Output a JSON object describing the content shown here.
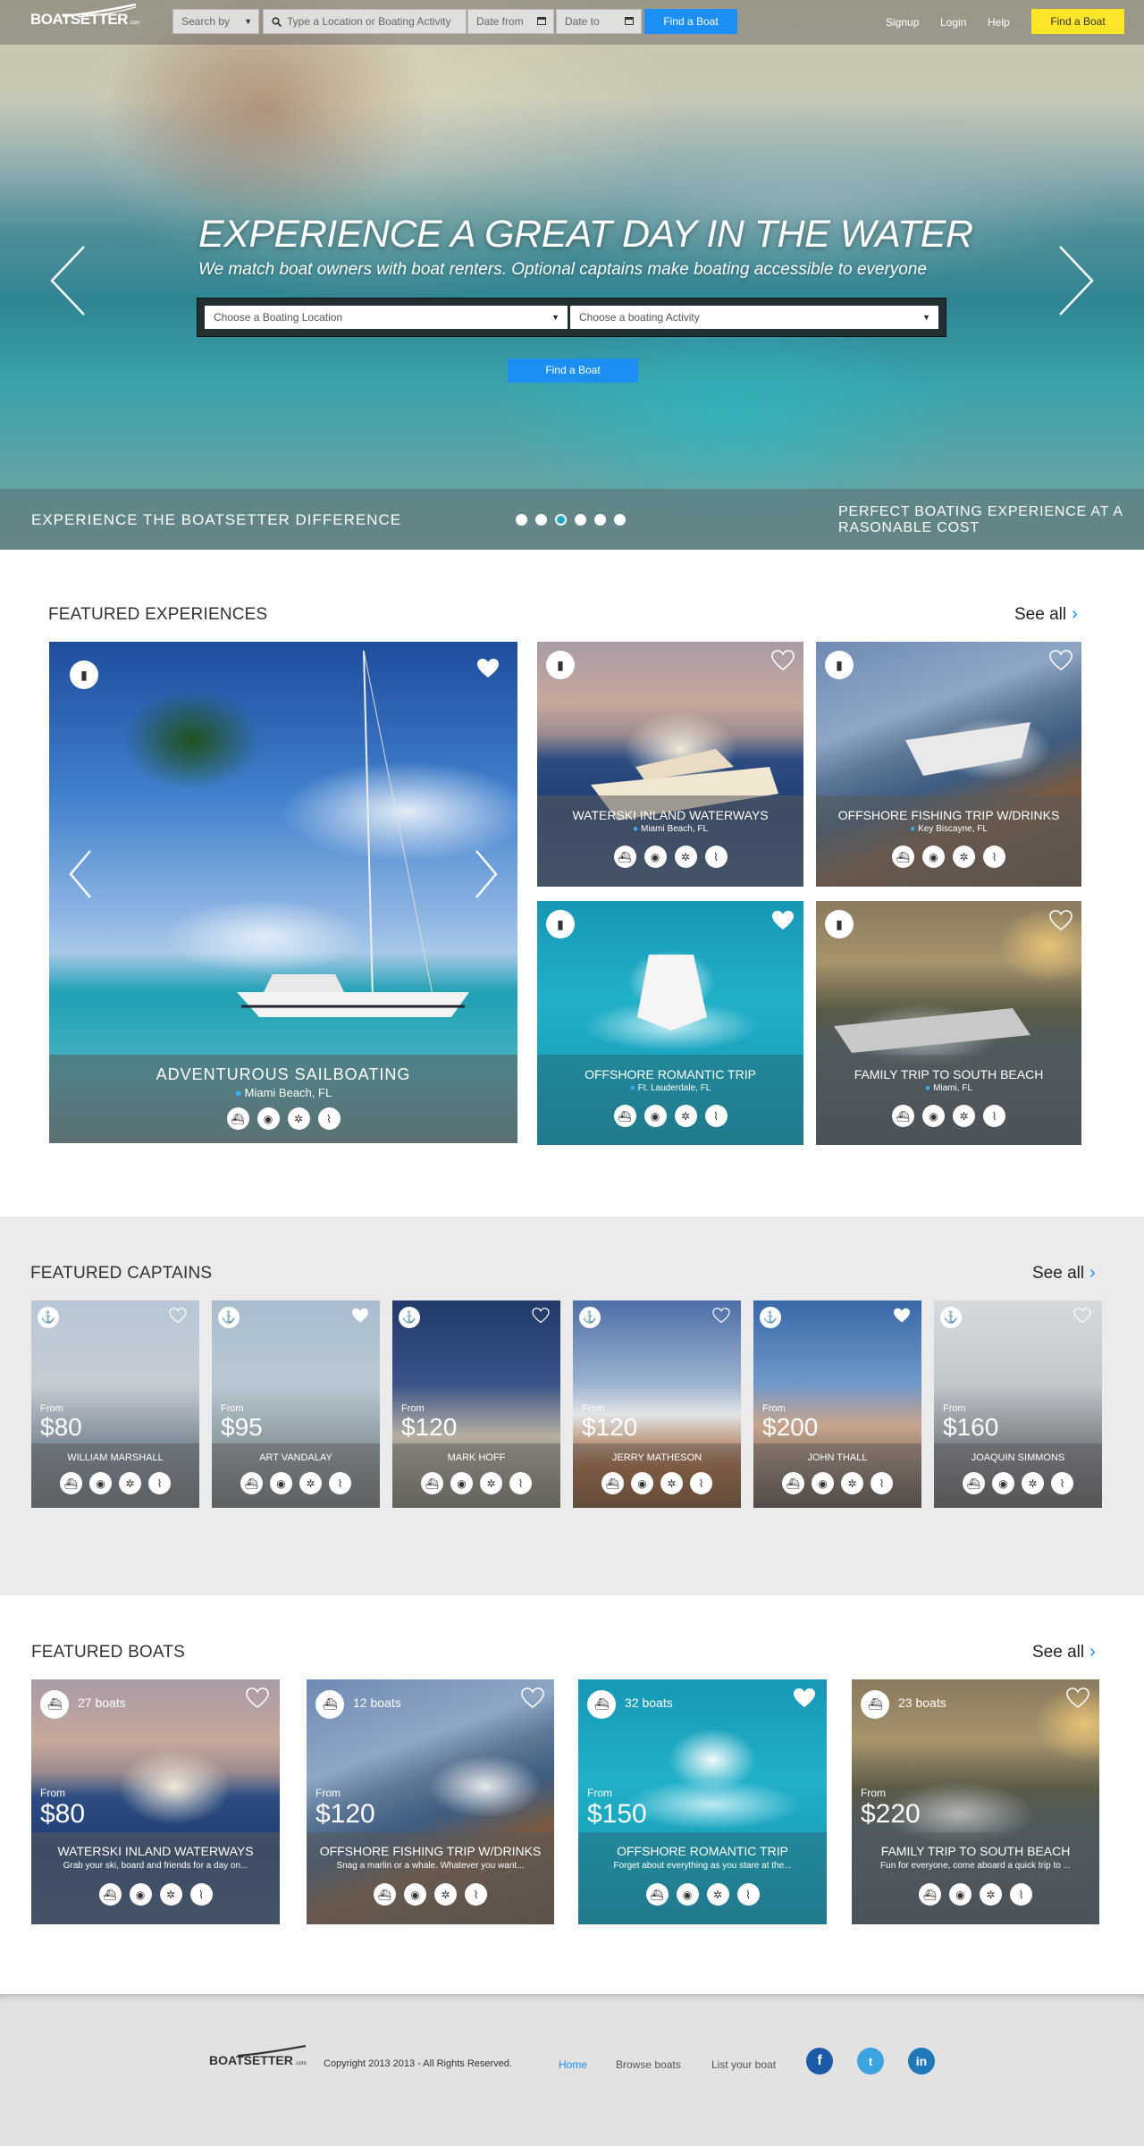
{
  "header": {
    "logo": "BOATSETTER",
    "logo_suffix": ".com",
    "search_by": "Search by",
    "location_placeholder": "Type a Location or Boating Activity",
    "date_from": "Date from",
    "date_to": "Date to",
    "find_button": "Find a Boat",
    "nav": {
      "signup": "Signup",
      "login": "Login",
      "help": "Help"
    },
    "cta": "Find a Boat"
  },
  "hero": {
    "title": "EXPERIENCE A GREAT DAY IN THE WATER",
    "subtitle": "We match boat owners with boat renters. Optional captains make boating accessible to everyone",
    "location_select": "Choose a Boating Location",
    "activity_select": "Choose a boating Activity",
    "find_button": "Find a Boat",
    "band_left": "EXPERIENCE THE BOATSETTER DIFFERENCE",
    "band_right": "PERFECT BOATING EXPERIENCE AT A RASONABLE COST",
    "slides_total": 6,
    "active_slide": 3
  },
  "experiences": {
    "title": "FEATURED EXPERIENCES",
    "see_all": "See all",
    "items": [
      {
        "title": "ADVENTUROUS SAILBOATING",
        "location": "Miami Beach, FL",
        "favorited": true
      },
      {
        "title": "WATERSKI INLAND WATERWAYS",
        "location": "Miami Beach, FL",
        "favorited": false
      },
      {
        "title": "OFFSHORE FISHING TRIP W/DRINKS",
        "location": "Key Biscayne, FL",
        "favorited": false
      },
      {
        "title": "OFFSHORE ROMANTIC TRIP",
        "location": "Ft. Lauderdale, FL",
        "favorited": true
      },
      {
        "title": "FAMILY TRIP TO SOUTH BEACH",
        "location": "Miami, FL",
        "favorited": false
      }
    ]
  },
  "captains": {
    "title": "FEATURED CAPTAINS",
    "see_all": "See all",
    "from_label": "From",
    "items": [
      {
        "name": "WILLIAM MARSHALL",
        "price": "$80",
        "favorited": false
      },
      {
        "name": "ART VANDALAY",
        "price": "$95",
        "favorited": true
      },
      {
        "name": "MARK HOFF",
        "price": "$120",
        "favorited": false
      },
      {
        "name": "JERRY MATHESON",
        "price": "$120",
        "favorited": false
      },
      {
        "name": "JOHN THALL",
        "price": "$200",
        "favorited": true
      },
      {
        "name": "JOAQUIN SIMMONS",
        "price": "$160",
        "favorited": false
      }
    ]
  },
  "boats": {
    "title": "FEATURED BOATS",
    "see_all": "See all",
    "from_label": "From",
    "items": [
      {
        "count": "27 boats",
        "price": "$80",
        "title": "WATERSKI INLAND WATERWAYS",
        "desc": "Grab your ski, board and friends for a day on...",
        "favorited": false
      },
      {
        "count": "12 boats",
        "price": "$120",
        "title": "OFFSHORE FISHING TRIP W/DRINKS",
        "desc": "Snag a marlin or a whale. Whatever you want...",
        "favorited": false
      },
      {
        "count": "32 boats",
        "price": "$150",
        "title": "OFFSHORE ROMANTIC TRIP",
        "desc": "Forget about everything as you stare at the...",
        "favorited": true
      },
      {
        "count": "23 boats",
        "price": "$220",
        "title": "FAMILY TRIP TO SOUTH BEACH",
        "desc": "Fun for everyone, come aboard a quick trip to ...",
        "favorited": false
      }
    ]
  },
  "footer": {
    "logo": "BOATSETTER",
    "logo_suffix": ".com",
    "copyright": "Copyright 2013 2013 - All Rights Reserved.",
    "links": [
      "Home",
      "Browse boats",
      "List your boat"
    ],
    "social": [
      "f",
      "t",
      "in"
    ]
  },
  "colors": {
    "accent": "#1b8ff4",
    "cta_yellow": "#ffe628",
    "facebook": "#1c5aa8",
    "twitter": "#3ba4e0",
    "linkedin": "#1f78b8"
  },
  "icons": [
    "boat-icon",
    "dining-icon",
    "helm-icon",
    "ski-icon",
    "book-icon",
    "anchor-icon",
    "heart-icon"
  ]
}
